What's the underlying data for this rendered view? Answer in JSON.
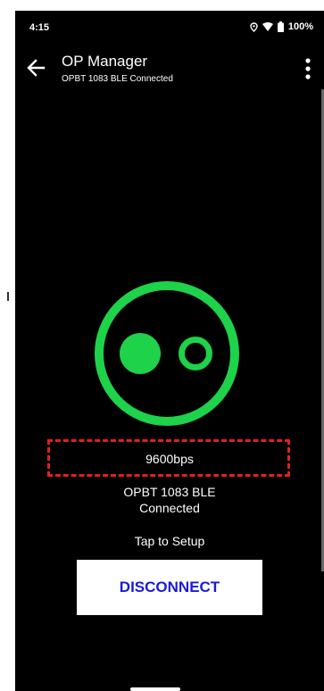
{
  "status_bar": {
    "time": "4:15",
    "battery_percent": "100%",
    "icons": [
      "location-icon",
      "wifi-icon",
      "battery-icon"
    ]
  },
  "app_bar": {
    "title": "OP Manager",
    "subtitle": "OPBT 1083 BLE Connected",
    "back_icon": "arrow-left-icon",
    "menu_icon": "more-vert-icon"
  },
  "main": {
    "status_icon": "connection-status-icon",
    "baud_rate": "9600bps",
    "device_name": "OPBT 1083 BLE",
    "connection_state": "Connected",
    "setup_link": "Tap to Setup",
    "disconnect_label": "DISCONNECT"
  },
  "colors": {
    "background": "#000000",
    "status_green": "#1ed24a",
    "highlight_red": "#e0201c",
    "button_text": "#1a1ad8",
    "button_bg": "#ffffff"
  }
}
